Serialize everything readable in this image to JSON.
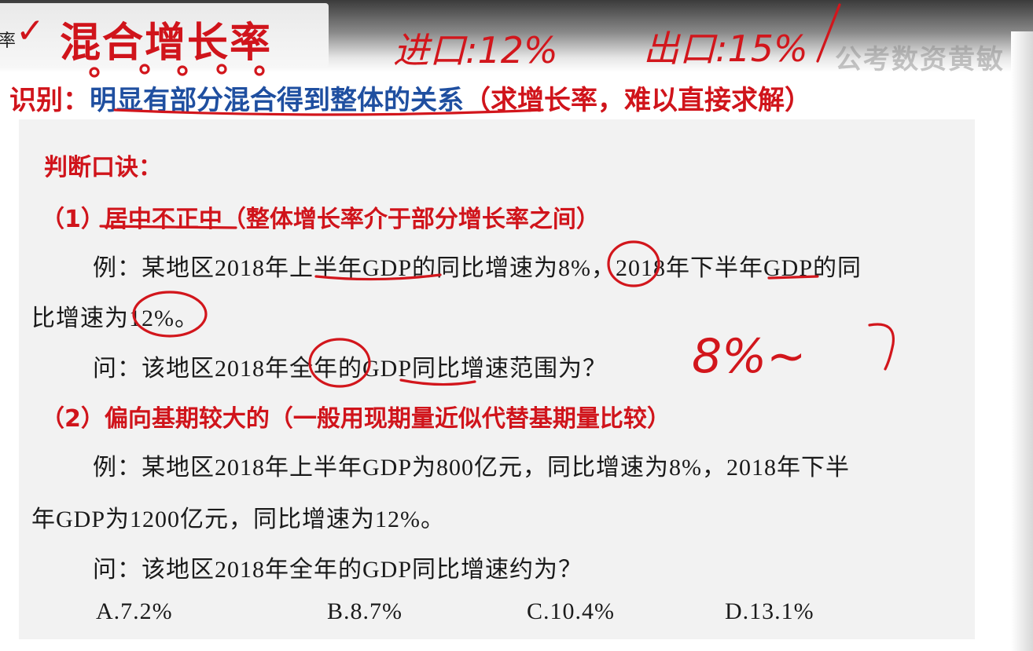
{
  "header": {
    "cut_char": "率",
    "check_mark": "✓",
    "title": "混合增长率",
    "watermark": "公考数资黄敏"
  },
  "identify": {
    "label": "识别：",
    "blue_text": "明显有部分混合得到整体的关系",
    "red_text": "（求增长率，难以直接求解）"
  },
  "rule_title": "判断口诀：",
  "point1": {
    "heading": "（1）居中不正中（整体增长率介于部分增长率之间）",
    "example_line1": "例：某地区2018年上半年GDP的同比增速为8%，2018年下半年GDP的同",
    "example_line2": "比增速为12%。",
    "question": "问：该地区2018年全年的GDP同比增速范围为？"
  },
  "point2": {
    "heading": "（2）偏向基期较大的（一般用现期量近似代替基期量比较）",
    "example_line1": "例：某地区2018年上半年GDP为800亿元，同比增速为8%，2018年下半",
    "example_line2": "年GDP为1200亿元，同比增速为12%。",
    "question": "问：该地区2018年全年的GDP同比增速约为？",
    "options": [
      "A.7.2%",
      "B.8.7%",
      "C.10.4%",
      "D.13.1%"
    ]
  },
  "handwriting": {
    "note_import": "进口:12%",
    "note_export": "出口:15%",
    "range_note": "8%~"
  },
  "colors": {
    "title_red": "#d0141b",
    "identify_blue": "#1f4fa0",
    "ink_red": "#d2161c",
    "content_bg": "#f2f2f2"
  }
}
